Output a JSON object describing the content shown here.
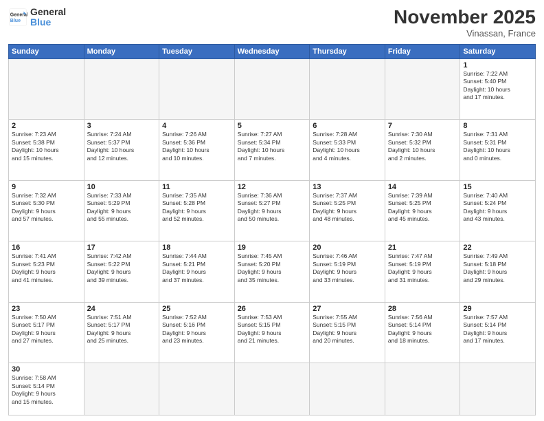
{
  "header": {
    "logo_general": "General",
    "logo_blue": "Blue",
    "month_title": "November 2025",
    "location": "Vinassan, France"
  },
  "weekdays": [
    "Sunday",
    "Monday",
    "Tuesday",
    "Wednesday",
    "Thursday",
    "Friday",
    "Saturday"
  ],
  "weeks": [
    [
      {
        "day": "",
        "info": ""
      },
      {
        "day": "",
        "info": ""
      },
      {
        "day": "",
        "info": ""
      },
      {
        "day": "",
        "info": ""
      },
      {
        "day": "",
        "info": ""
      },
      {
        "day": "",
        "info": ""
      },
      {
        "day": "1",
        "info": "Sunrise: 7:22 AM\nSunset: 5:40 PM\nDaylight: 10 hours\nand 17 minutes."
      }
    ],
    [
      {
        "day": "2",
        "info": "Sunrise: 7:23 AM\nSunset: 5:38 PM\nDaylight: 10 hours\nand 15 minutes."
      },
      {
        "day": "3",
        "info": "Sunrise: 7:24 AM\nSunset: 5:37 PM\nDaylight: 10 hours\nand 12 minutes."
      },
      {
        "day": "4",
        "info": "Sunrise: 7:26 AM\nSunset: 5:36 PM\nDaylight: 10 hours\nand 10 minutes."
      },
      {
        "day": "5",
        "info": "Sunrise: 7:27 AM\nSunset: 5:34 PM\nDaylight: 10 hours\nand 7 minutes."
      },
      {
        "day": "6",
        "info": "Sunrise: 7:28 AM\nSunset: 5:33 PM\nDaylight: 10 hours\nand 4 minutes."
      },
      {
        "day": "7",
        "info": "Sunrise: 7:30 AM\nSunset: 5:32 PM\nDaylight: 10 hours\nand 2 minutes."
      },
      {
        "day": "8",
        "info": "Sunrise: 7:31 AM\nSunset: 5:31 PM\nDaylight: 10 hours\nand 0 minutes."
      }
    ],
    [
      {
        "day": "9",
        "info": "Sunrise: 7:32 AM\nSunset: 5:30 PM\nDaylight: 9 hours\nand 57 minutes."
      },
      {
        "day": "10",
        "info": "Sunrise: 7:33 AM\nSunset: 5:29 PM\nDaylight: 9 hours\nand 55 minutes."
      },
      {
        "day": "11",
        "info": "Sunrise: 7:35 AM\nSunset: 5:28 PM\nDaylight: 9 hours\nand 52 minutes."
      },
      {
        "day": "12",
        "info": "Sunrise: 7:36 AM\nSunset: 5:27 PM\nDaylight: 9 hours\nand 50 minutes."
      },
      {
        "day": "13",
        "info": "Sunrise: 7:37 AM\nSunset: 5:25 PM\nDaylight: 9 hours\nand 48 minutes."
      },
      {
        "day": "14",
        "info": "Sunrise: 7:39 AM\nSunset: 5:25 PM\nDaylight: 9 hours\nand 45 minutes."
      },
      {
        "day": "15",
        "info": "Sunrise: 7:40 AM\nSunset: 5:24 PM\nDaylight: 9 hours\nand 43 minutes."
      }
    ],
    [
      {
        "day": "16",
        "info": "Sunrise: 7:41 AM\nSunset: 5:23 PM\nDaylight: 9 hours\nand 41 minutes."
      },
      {
        "day": "17",
        "info": "Sunrise: 7:42 AM\nSunset: 5:22 PM\nDaylight: 9 hours\nand 39 minutes."
      },
      {
        "day": "18",
        "info": "Sunrise: 7:44 AM\nSunset: 5:21 PM\nDaylight: 9 hours\nand 37 minutes."
      },
      {
        "day": "19",
        "info": "Sunrise: 7:45 AM\nSunset: 5:20 PM\nDaylight: 9 hours\nand 35 minutes."
      },
      {
        "day": "20",
        "info": "Sunrise: 7:46 AM\nSunset: 5:19 PM\nDaylight: 9 hours\nand 33 minutes."
      },
      {
        "day": "21",
        "info": "Sunrise: 7:47 AM\nSunset: 5:19 PM\nDaylight: 9 hours\nand 31 minutes."
      },
      {
        "day": "22",
        "info": "Sunrise: 7:49 AM\nSunset: 5:18 PM\nDaylight: 9 hours\nand 29 minutes."
      }
    ],
    [
      {
        "day": "23",
        "info": "Sunrise: 7:50 AM\nSunset: 5:17 PM\nDaylight: 9 hours\nand 27 minutes."
      },
      {
        "day": "24",
        "info": "Sunrise: 7:51 AM\nSunset: 5:17 PM\nDaylight: 9 hours\nand 25 minutes."
      },
      {
        "day": "25",
        "info": "Sunrise: 7:52 AM\nSunset: 5:16 PM\nDaylight: 9 hours\nand 23 minutes."
      },
      {
        "day": "26",
        "info": "Sunrise: 7:53 AM\nSunset: 5:15 PM\nDaylight: 9 hours\nand 21 minutes."
      },
      {
        "day": "27",
        "info": "Sunrise: 7:55 AM\nSunset: 5:15 PM\nDaylight: 9 hours\nand 20 minutes."
      },
      {
        "day": "28",
        "info": "Sunrise: 7:56 AM\nSunset: 5:14 PM\nDaylight: 9 hours\nand 18 minutes."
      },
      {
        "day": "29",
        "info": "Sunrise: 7:57 AM\nSunset: 5:14 PM\nDaylight: 9 hours\nand 17 minutes."
      }
    ],
    [
      {
        "day": "30",
        "info": "Sunrise: 7:58 AM\nSunset: 5:14 PM\nDaylight: 9 hours\nand 15 minutes."
      },
      {
        "day": "",
        "info": ""
      },
      {
        "day": "",
        "info": ""
      },
      {
        "day": "",
        "info": ""
      },
      {
        "day": "",
        "info": ""
      },
      {
        "day": "",
        "info": ""
      },
      {
        "day": "",
        "info": ""
      }
    ]
  ]
}
